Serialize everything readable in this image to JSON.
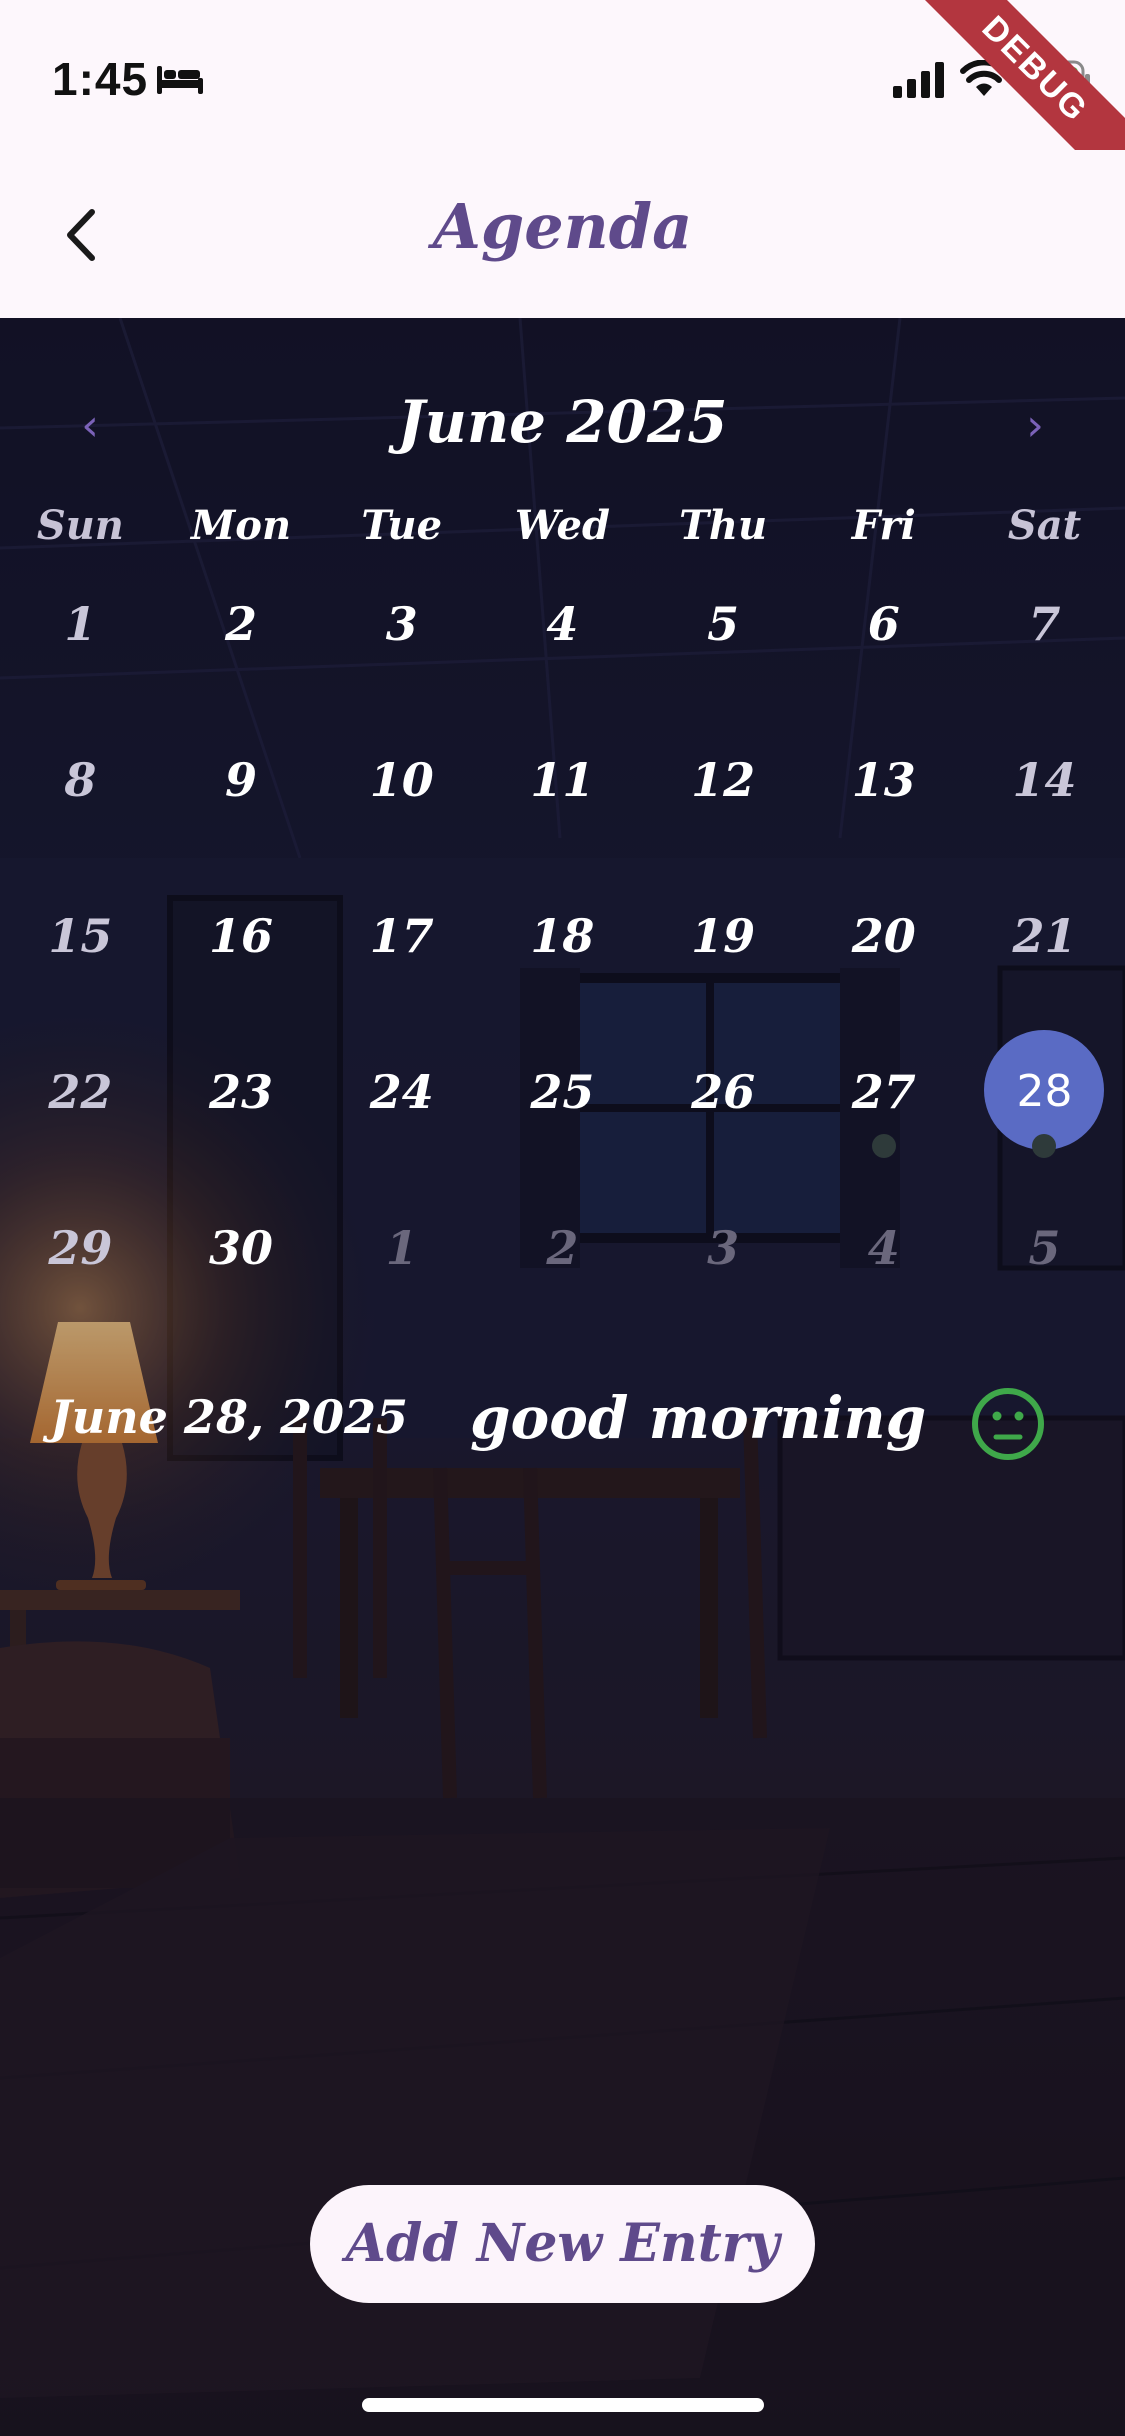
{
  "status_bar": {
    "time": "1:45",
    "icons": [
      "bed-icon",
      "cellular-signal-icon",
      "wifi-icon",
      "battery-charging-icon"
    ],
    "debug_banner": "DEBUG"
  },
  "app_bar": {
    "back_icon": "chevron-left-icon",
    "title": "Agenda"
  },
  "calendar": {
    "prev_icon": "‹",
    "next_icon": "›",
    "month_label": "June 2025",
    "weekdays": [
      "Sun",
      "Mon",
      "Tue",
      "Wed",
      "Thu",
      "Fri",
      "Sat"
    ],
    "weeks": [
      [
        "1",
        "2",
        "3",
        "4",
        "5",
        "6",
        "7"
      ],
      [
        "8",
        "9",
        "10",
        "11",
        "12",
        "13",
        "14"
      ],
      [
        "15",
        "16",
        "17",
        "18",
        "19",
        "20",
        "21"
      ],
      [
        "22",
        "23",
        "24",
        "25",
        "26",
        "27",
        "28"
      ],
      [
        "29",
        "30",
        "1",
        "2",
        "3",
        "4",
        "5"
      ]
    ],
    "selected_day": "28",
    "days_with_events": [
      "27",
      "28"
    ]
  },
  "entry": {
    "date": "June 28, 2025",
    "title": "good morning",
    "mood_icon": "neutral-face-icon"
  },
  "add_button": {
    "label": "Add New Entry"
  },
  "colors": {
    "accent_purple": "#5f4a8b",
    "selected_day": "#5a6bc4",
    "mood_green": "#3fa84a",
    "app_bar_bg": "#fdf7fc",
    "debug_banner": "#b3363f"
  }
}
